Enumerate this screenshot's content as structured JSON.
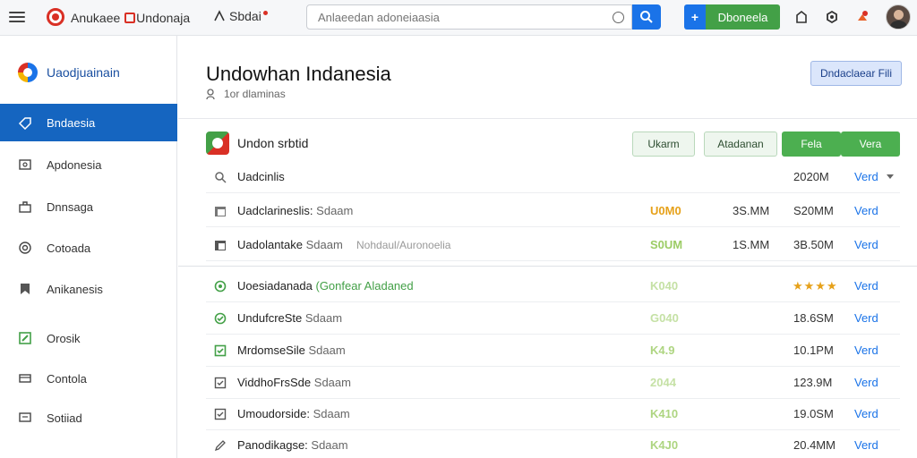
{
  "topbar": {
    "brand_a": "Anukaee",
    "brand_b": "Undonaja",
    "home_label": "Sbdai",
    "search_placeholder": "Anlaeedan adoneiaasia",
    "action_label": "Dboneela",
    "action_plus": "+"
  },
  "sidebar": {
    "brand": "Uaodjuainain",
    "items": [
      {
        "label": "Bndaesia",
        "icon": "tag-icon"
      },
      {
        "label": "Apdonesia",
        "icon": "screen-icon"
      },
      {
        "label": "Dnnsaga",
        "icon": "briefcase-icon"
      },
      {
        "label": "Cotoada",
        "icon": "target-icon"
      },
      {
        "label": "Anikanesis",
        "icon": "bookmark-icon"
      },
      {
        "label": "Orosik",
        "icon": "edit-icon"
      },
      {
        "label": "Contola",
        "icon": "card-icon"
      },
      {
        "label": "Sotiiad",
        "icon": "chat-icon"
      }
    ]
  },
  "main": {
    "title": "Undowhan Indanesia",
    "subtitle": "1or dlaminas",
    "download_label": "Dndaclaear Fili",
    "list_title": "Undon srbtid",
    "pills": [
      "Ukarm",
      "Atadanan",
      "Fela",
      "Vera"
    ],
    "rows": [
      {
        "icon": "search-icon",
        "name": "Uadcinlis",
        "extra": "",
        "tag": "",
        "price": "",
        "price_color": "",
        "c2": "",
        "c3": "2020M",
        "link": "Verd",
        "chevron": true
      },
      {
        "icon": "folder-icon",
        "name": "Uadclarineslis:",
        "extra": "Sdaam",
        "tag": "",
        "price": "U0M0",
        "price_color": "#e6a11a",
        "c2": "3S.MM",
        "c3": "S20MM",
        "link": "Verd",
        "chevron": false
      },
      {
        "icon": "folder-icon",
        "name": "Uadolantake",
        "extra": "Sdaam",
        "tag": "Nohdaul/Auronoelia",
        "price": "S0UM",
        "price_color": "#9ccc65",
        "c2": "1S.MM",
        "c3": "3B.50M",
        "link": "Verd",
        "chevron": false
      }
    ],
    "featured_rows": [
      {
        "icon": "status-circle-icon",
        "name": "Uoesiadanada",
        "highlight": "(Gonfear Aladaned",
        "price": "K040",
        "price_color": "#c5e1a5",
        "stars": "★★★★",
        "c3": "",
        "link": "Verd"
      },
      {
        "icon": "check-circle-icon",
        "name": "UndufcreSte",
        "highlight": "",
        "extra": "Sdaam",
        "price": "G040",
        "price_color": "#c5e1a5",
        "stars": "",
        "c3": "18.6SM",
        "link": "Verd"
      },
      {
        "icon": "check-box-icon",
        "name": "MrdomseSile",
        "highlight": "",
        "extra": "Sdaam",
        "price": "K4.9",
        "price_color": "#aed581",
        "stars": "",
        "c3": "10.1PM",
        "link": "Verd"
      },
      {
        "icon": "check-box-icon",
        "name": "ViddhoFrsSde",
        "highlight": "",
        "extra": "Sdaam",
        "price": "2044",
        "price_color": "#c5e1a5",
        "stars": "",
        "c3": "123.9M",
        "link": "Verd"
      },
      {
        "icon": "check-box-icon",
        "name": "Umoudorside:",
        "highlight": "",
        "extra": "Sdaam",
        "price": "K410",
        "price_color": "#aed581",
        "stars": "",
        "c3": "19.0SM",
        "link": "Verd"
      },
      {
        "icon": "pen-icon",
        "name": "Panodikagse:",
        "highlight": "",
        "extra": "Sdaam",
        "price": "K4J0",
        "price_color": "#aed581",
        "stars": "",
        "c3": "20.4MM",
        "link": "Verd"
      }
    ]
  },
  "colors": {
    "accent": "#1a73e8",
    "green": "#43a047",
    "sidebar_active": "#1565c0",
    "brand_red": "#d93025"
  }
}
